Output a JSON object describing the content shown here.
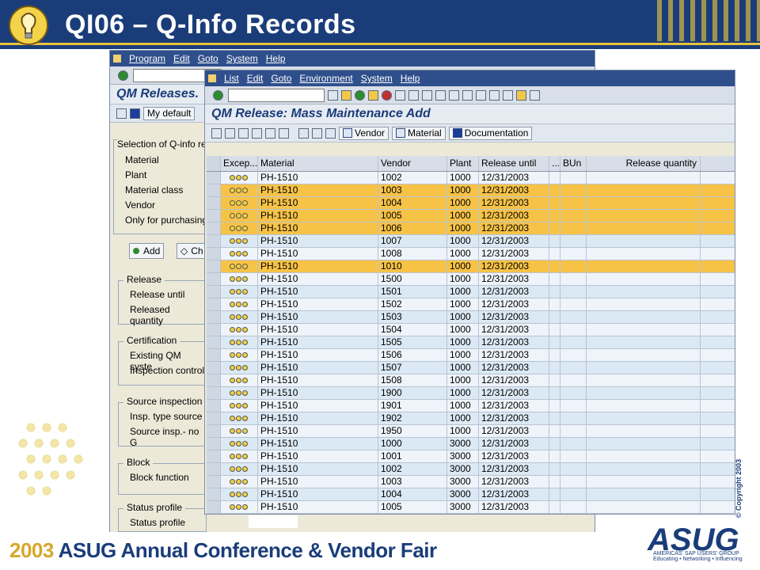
{
  "slide": {
    "title": "QI06 – Q-Info Records",
    "footer_year": "2003",
    "footer_text": "ASUG Annual Conference & Vendor Fair",
    "brand": "ASUG",
    "brand_sub": "AMERICAS' SAP USERS' GROUP",
    "brand_tagline": "Educating • Networking • Influencing",
    "copyright": "© Copyright 2003"
  },
  "back_window": {
    "menu": [
      "Program",
      "Edit",
      "Goto",
      "System",
      "Help"
    ],
    "title": "QM Releases.",
    "my_default_label": "My default",
    "selection_label": "Selection of Q-info re",
    "selection_fields": [
      "Material",
      "Plant",
      "Material class",
      "Vendor",
      "Only for purchasing"
    ],
    "tab_add": "Add",
    "tab_change": "Ch",
    "groups": [
      {
        "label": "Release",
        "fields": [
          "Release until",
          "Released quantity"
        ]
      },
      {
        "label": "Certification",
        "fields": [
          "Existing QM syste",
          "Inspection control"
        ]
      },
      {
        "label": "Source inspection",
        "fields": [
          "Insp. type source",
          "Source insp.- no G"
        ]
      },
      {
        "label": "Block",
        "fields": [
          "Block function"
        ]
      },
      {
        "label": "Status profile",
        "fields": [
          "Status profile"
        ]
      }
    ]
  },
  "front_window": {
    "menu": [
      "List",
      "Edit",
      "Goto",
      "Environment",
      "System",
      "Help"
    ],
    "title": "QM Release: Mass Maintenance Add",
    "buttons": {
      "vendor": "Vendor",
      "material": "Material",
      "documentation": "Documentation"
    },
    "columns": {
      "exceptions": "Excep...",
      "material": "Material",
      "vendor": "Vendor",
      "plant": "Plant",
      "release_until": "Release until",
      "more": "...",
      "bun": "BUn",
      "release_quantity": "Release quantity"
    },
    "rows": [
      {
        "material": "PH-1510",
        "vendor": "1002",
        "plant": "1000",
        "release_until": "12/31/2003",
        "highlight": false
      },
      {
        "material": "PH-1510",
        "vendor": "1003",
        "plant": "1000",
        "release_until": "12/31/2003",
        "highlight": true
      },
      {
        "material": "PH-1510",
        "vendor": "1004",
        "plant": "1000",
        "release_until": "12/31/2003",
        "highlight": true
      },
      {
        "material": "PH-1510",
        "vendor": "1005",
        "plant": "1000",
        "release_until": "12/31/2003",
        "highlight": true
      },
      {
        "material": "PH-1510",
        "vendor": "1006",
        "plant": "1000",
        "release_until": "12/31/2003",
        "highlight": true
      },
      {
        "material": "PH-1510",
        "vendor": "1007",
        "plant": "1000",
        "release_until": "12/31/2003",
        "highlight": false
      },
      {
        "material": "PH-1510",
        "vendor": "1008",
        "plant": "1000",
        "release_until": "12/31/2003",
        "highlight": false
      },
      {
        "material": "PH-1510",
        "vendor": "1010",
        "plant": "1000",
        "release_until": "12/31/2003",
        "highlight": true
      },
      {
        "material": "PH-1510",
        "vendor": "1500",
        "plant": "1000",
        "release_until": "12/31/2003",
        "highlight": false
      },
      {
        "material": "PH-1510",
        "vendor": "1501",
        "plant": "1000",
        "release_until": "12/31/2003",
        "highlight": false
      },
      {
        "material": "PH-1510",
        "vendor": "1502",
        "plant": "1000",
        "release_until": "12/31/2003",
        "highlight": false
      },
      {
        "material": "PH-1510",
        "vendor": "1503",
        "plant": "1000",
        "release_until": "12/31/2003",
        "highlight": false
      },
      {
        "material": "PH-1510",
        "vendor": "1504",
        "plant": "1000",
        "release_until": "12/31/2003",
        "highlight": false
      },
      {
        "material": "PH-1510",
        "vendor": "1505",
        "plant": "1000",
        "release_until": "12/31/2003",
        "highlight": false
      },
      {
        "material": "PH-1510",
        "vendor": "1506",
        "plant": "1000",
        "release_until": "12/31/2003",
        "highlight": false
      },
      {
        "material": "PH-1510",
        "vendor": "1507",
        "plant": "1000",
        "release_until": "12/31/2003",
        "highlight": false
      },
      {
        "material": "PH-1510",
        "vendor": "1508",
        "plant": "1000",
        "release_until": "12/31/2003",
        "highlight": false
      },
      {
        "material": "PH-1510",
        "vendor": "1900",
        "plant": "1000",
        "release_until": "12/31/2003",
        "highlight": false
      },
      {
        "material": "PH-1510",
        "vendor": "1901",
        "plant": "1000",
        "release_until": "12/31/2003",
        "highlight": false
      },
      {
        "material": "PH-1510",
        "vendor": "1902",
        "plant": "1000",
        "release_until": "12/31/2003",
        "highlight": false
      },
      {
        "material": "PH-1510",
        "vendor": "1950",
        "plant": "1000",
        "release_until": "12/31/2003",
        "highlight": false
      },
      {
        "material": "PH-1510",
        "vendor": "1000",
        "plant": "3000",
        "release_until": "12/31/2003",
        "highlight": false
      },
      {
        "material": "PH-1510",
        "vendor": "1001",
        "plant": "3000",
        "release_until": "12/31/2003",
        "highlight": false
      },
      {
        "material": "PH-1510",
        "vendor": "1002",
        "plant": "3000",
        "release_until": "12/31/2003",
        "highlight": false
      },
      {
        "material": "PH-1510",
        "vendor": "1003",
        "plant": "3000",
        "release_until": "12/31/2003",
        "highlight": false
      },
      {
        "material": "PH-1510",
        "vendor": "1004",
        "plant": "3000",
        "release_until": "12/31/2003",
        "highlight": false
      },
      {
        "material": "PH-1510",
        "vendor": "1005",
        "plant": "3000",
        "release_until": "12/31/2003",
        "highlight": false
      }
    ]
  }
}
